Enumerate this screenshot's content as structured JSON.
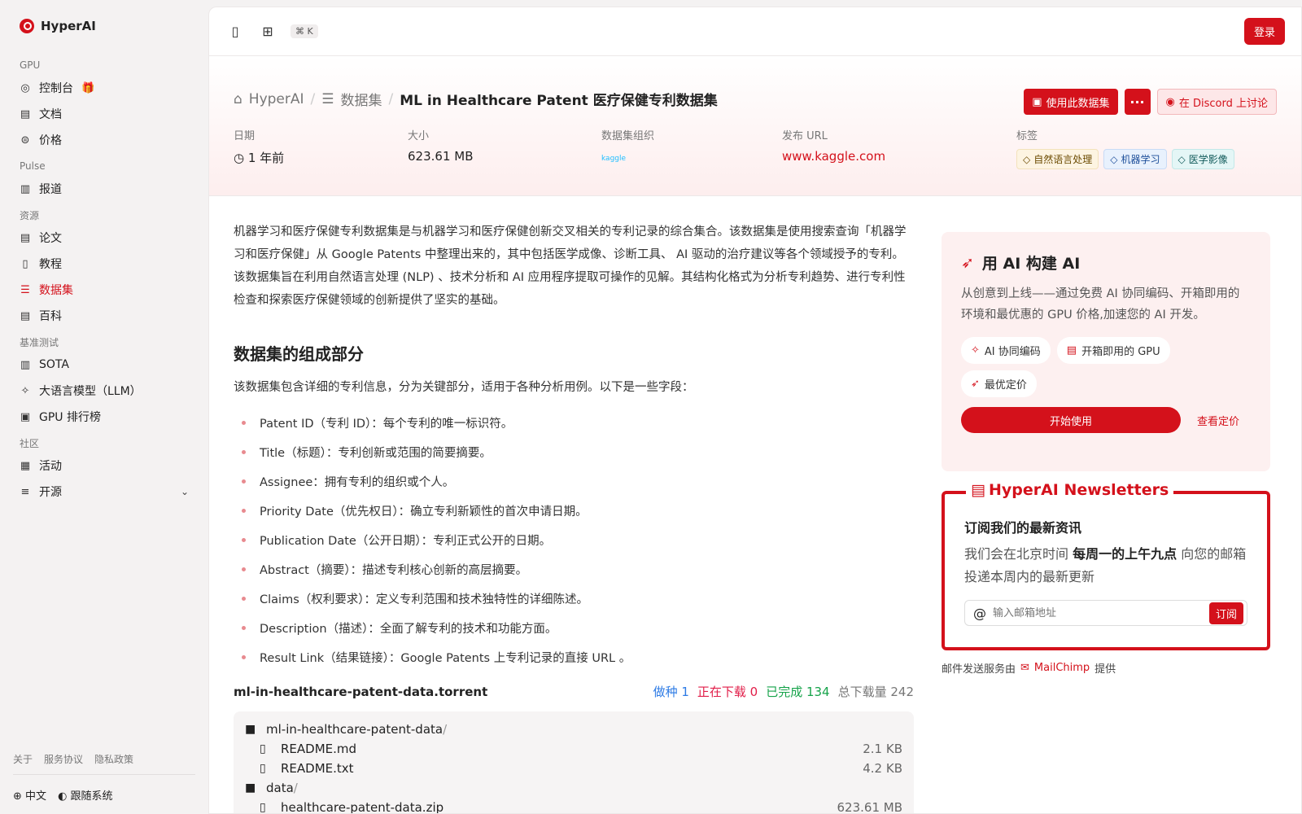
{
  "brand": "HyperAI",
  "sidebar": {
    "groups": [
      {
        "label": "GPU",
        "items": [
          {
            "label": "控制台",
            "icon": "gauge-icon"
          },
          {
            "label": "文档",
            "icon": "book-icon"
          },
          {
            "label": "价格",
            "icon": "price-icon"
          }
        ]
      },
      {
        "label": "Pulse",
        "items": [
          {
            "label": "报道",
            "icon": "news-icon"
          }
        ]
      },
      {
        "label": "资源",
        "items": [
          {
            "label": "论文",
            "icon": "paper-icon"
          },
          {
            "label": "教程",
            "icon": "tutorial-icon"
          },
          {
            "label": "数据集",
            "icon": "database-icon",
            "active": true
          },
          {
            "label": "百科",
            "icon": "wiki-icon"
          }
        ]
      },
      {
        "label": "基准测试",
        "items": [
          {
            "label": "SOTA",
            "icon": "bar-chart-icon"
          },
          {
            "label": "大语言模型（LLM）",
            "icon": "sparkle-icon"
          },
          {
            "label": "GPU 排行榜",
            "icon": "chip-icon"
          }
        ]
      },
      {
        "label": "社区",
        "items": [
          {
            "label": "活动",
            "icon": "calendar-icon"
          },
          {
            "label": "开源",
            "icon": "list-icon"
          }
        ]
      }
    ],
    "footer_links": [
      "关于",
      "服务协议",
      "隐私政策"
    ],
    "language": "中文",
    "theme": "跟随系统"
  },
  "topbar": {
    "shortcut": "⌘ K",
    "login_label": "登录"
  },
  "breadcrumb": {
    "home": "HyperAI",
    "section": "数据集",
    "current": "ML in Healthcare Patent 医疗保健专利数据集"
  },
  "actions": {
    "use_dataset": "使用此数据集",
    "discord": "在 Discord 上讨论"
  },
  "meta": {
    "date_label": "日期",
    "date_value": "1 年前",
    "size_label": "大小",
    "size_value": "623.61 MB",
    "org_label": "数据集组织",
    "org_value": "kaggle",
    "url_label": "发布 URL",
    "url_value": "www.kaggle.com",
    "tags_label": "标签",
    "tags": [
      "自然语言处理",
      "机器学习",
      "医学影像"
    ]
  },
  "description": "机器学习和医疗保健专利数据集是与机器学习和医疗保健创新交叉相关的专利记录的综合集合。该数据集是使用搜索查询「机器学习和医疗保健」从 Google Patents 中整理出来的，其中包括医学成像、诊断工具、 AI 驱动的治疗建议等各个领域授予的专利。 该数据集旨在利用自然语言处理 (NLP) 、技术分析和 AI 应用程序提取可操作的见解。其结构化格式为分析专利趋势、进行专利性检查和探索医疗保健领域的创新提供了坚实的基础。",
  "section_title": "数据集的组成部分",
  "section_intro": "该数据集包含详细的专利信息，分为关键部分，适用于各种分析用例。以下是一些字段：",
  "fields": [
    "Patent ID（专利 ID）：每个专利的唯一标识符。",
    "Title（标题）：专利创新或范围的简要摘要。",
    "Assignee：拥有专利的组织或个人。",
    "Priority Date（优先权日）：确立专利新颖性的首次申请日期。",
    "Publication Date（公开日期）：专利正式公开的日期。",
    "Abstract（摘要）：描述专利核心创新的高层摘要。",
    "Claims（权利要求）：定义专利范围和技术独特性的详细陈述。",
    "Description（描述）：全面了解专利的技术和功能方面。",
    "Result Link（结果链接）：Google Patents 上专利记录的直接 URL 。"
  ],
  "torrent": {
    "name": "ml-in-healthcare-patent-data.torrent",
    "seeding": "做种 1",
    "downloading": "正在下载 0",
    "completed": "已完成 134",
    "total": "总下载量 242",
    "files": [
      {
        "name": "ml-in-healthcare-patent-data",
        "type": "folder",
        "size": ""
      },
      {
        "name": "README.md",
        "type": "file",
        "size": "2.1 KB"
      },
      {
        "name": "README.txt",
        "type": "file",
        "size": "4.2 KB"
      },
      {
        "name": "data",
        "type": "folder",
        "size": ""
      },
      {
        "name": "healthcare-patent-data.zip",
        "type": "file",
        "size": "623.61 MB"
      }
    ]
  },
  "ai_card": {
    "title": "用 AI 构建 AI",
    "desc": "从创意到上线——通过免费 AI 协同编码、开箱即用的环境和最优惠的 GPU 价格,加速您的 AI 开发。",
    "chips": [
      "AI 协同编码",
      "开箱即用的 GPU",
      "最优定价"
    ],
    "start": "开始使用",
    "pricing": "查看定价"
  },
  "newsletter": {
    "title": "HyperAI Newsletters",
    "subtitle": "订阅我们的最新资讯",
    "text_pre": "我们会在北京时间 ",
    "text_bold": "每周一的上午九点",
    "text_post": " 向您的邮箱投递本周内的最新更新",
    "placeholder": "输入邮箱地址",
    "subscribe": "订阅",
    "powered_pre": "邮件发送服务由",
    "powered_brand": "MailChimp",
    "powered_post": "提供"
  },
  "colors": {
    "accent": "#d4111b"
  }
}
